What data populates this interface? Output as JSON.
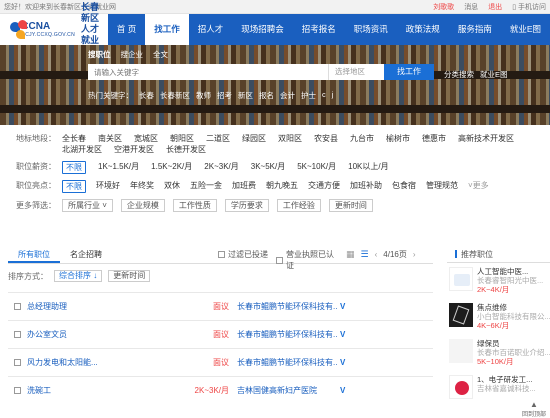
{
  "topbar": {
    "greeting": "您好！欢迎来到长春新区人才就业网",
    "links": [
      "刘歌歌",
      "消息",
      "退出",
      "手机访问"
    ]
  },
  "brand": {
    "logo_abbr": "CCNA",
    "site_name": "长春新区人才就业网",
    "domain": "RCJY.CCXQ.GOV.CN"
  },
  "nav": {
    "items": [
      "首 页",
      "找工作",
      "招人才",
      "现场招聘会",
      "招考报名",
      "职场资讯",
      "政策法规",
      "服务指南",
      "就业E图"
    ],
    "active_index": 1
  },
  "search": {
    "tabs": [
      "搜职位",
      "搜企业",
      "全文"
    ],
    "placeholder": "请输入关键字",
    "area_placeholder": "选择地区",
    "button": "找工作",
    "advanced": [
      "分类搜索",
      "就业E图"
    ],
    "hot_label": "热门关键字：",
    "hot_words": [
      "长春",
      "长春新区",
      "教师",
      "招考",
      "新区",
      "报名",
      "会计",
      "护士",
      "c",
      "j"
    ]
  },
  "filters": {
    "area": {
      "label": "地标地段：",
      "options": [
        "全长春",
        "南关区",
        "宽城区",
        "朝阳区",
        "二道区",
        "绿园区",
        "双阳区",
        "农安县",
        "九台市",
        "榆树市",
        "德惠市",
        "高新技术开发区",
        "北湖开发区",
        "空港开发区",
        "长德开发区"
      ]
    },
    "salary": {
      "label": "职位薪资：",
      "options": [
        "不限",
        "1K~1.5K/月",
        "1.5K~2K/月",
        "2K~3K/月",
        "3K~5K/月",
        "5K~10K/月",
        "10K以上/月"
      ],
      "selected": 0
    },
    "benefits": {
      "label": "职位亮点：",
      "options": [
        "不限",
        "环境好",
        "年终奖",
        "双休",
        "五险一金",
        "加班费",
        "朝九晚五",
        "交通方便",
        "加班补助",
        "包食宿",
        "管理规范"
      ],
      "selected": 0,
      "more": "更多"
    },
    "more": {
      "label": "更多筛选：",
      "boxes": [
        "所属行业",
        "企业规模",
        "工作性质",
        "学历要求",
        "工作经验",
        "更新时间"
      ]
    }
  },
  "results": {
    "tabs": [
      "所有职位",
      "名企招聘"
    ],
    "active_tab": 0,
    "check_applied": "过滤已投递",
    "check_license": "营业执照已认证",
    "page": "4/16页",
    "sort_label": "排序方式：",
    "sort_options": [
      "综合排序",
      "更新时间"
    ],
    "jobs": [
      {
        "title": "总经理助理",
        "salary": "面议",
        "company": "长春市鲲鹏节能环保科技有..."
      },
      {
        "title": "办公室文员",
        "salary": "面议",
        "company": "长春市鲲鹏节能环保科技有..."
      },
      {
        "title": "风力发电和太阳能...",
        "salary": "面议",
        "company": "长春市鲲鹏节能环保科技有..."
      },
      {
        "title": "洗碗工",
        "salary": "2K~3K/月",
        "company": "吉林国健高新妇产医院"
      }
    ]
  },
  "sidebar": {
    "title": "推荐职位",
    "items": [
      {
        "job": "人工智能中医...",
        "company": "长春睿智阳光中医...",
        "salary": "2K~4K/月"
      },
      {
        "job": "焦点维修",
        "company": "小白智能科技有限公...",
        "salary": "4K~6K/月"
      },
      {
        "job": "绿保员",
        "company": "长春市百诺职业介绍...",
        "salary": "5K~10K/月"
      },
      {
        "job": "1、电子研发工...",
        "company": "吉林省嘉诚科技...",
        "salary": ""
      }
    ],
    "scroll_top": "回到顶部"
  }
}
